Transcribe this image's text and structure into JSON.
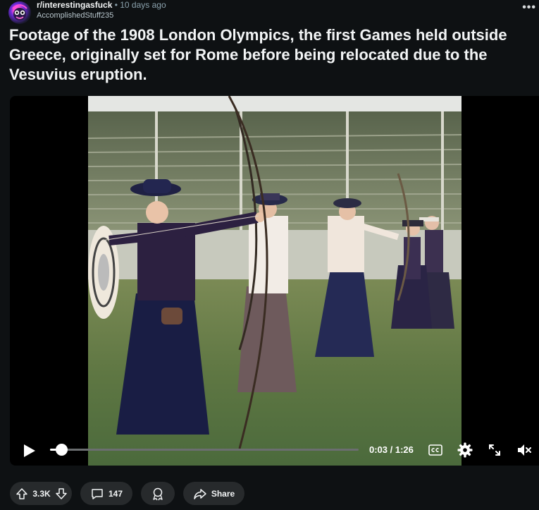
{
  "post": {
    "subreddit": "r/interestingasfuck",
    "time": "• 10 days ago",
    "author": "AccomplishedStuff235",
    "more_label": "•••",
    "title": "Footage of the 1908 London Olympics, the first Games held outside Greece, originally set for Rome before being relocated due to the Vesuvius eruption."
  },
  "player": {
    "progress_fraction": 0.036,
    "timecode": "0:03 / 1:26",
    "icons": [
      "play-icon",
      "captions-icon",
      "settings-icon",
      "fullscreen-icon",
      "volume-muted-icon"
    ]
  },
  "actions": {
    "votes": "3.3K",
    "comments": "147",
    "share_label": "Share",
    "icons": [
      "upvote-icon",
      "downvote-icon",
      "comment-icon",
      "award-icon",
      "share-icon"
    ]
  }
}
